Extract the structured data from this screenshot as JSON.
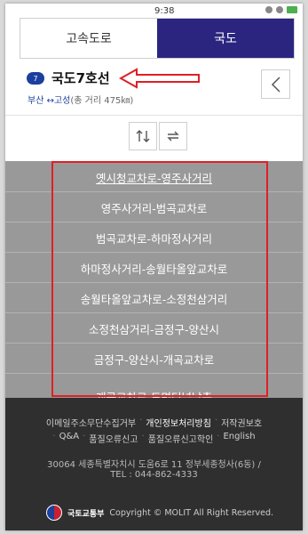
{
  "status_bar": {
    "time": "9:38"
  },
  "tabs": [
    {
      "label": "고속도로",
      "active": false
    },
    {
      "label": "국도",
      "active": true
    }
  ],
  "route": {
    "number": "7",
    "name": "국도7호선",
    "start": "부산",
    "arrow": "↔",
    "end": "고성",
    "distance": "(총 거리 475㎞)"
  },
  "controls": {
    "swap_icon": "swap-vertical-icon",
    "refresh_icon": "refresh-icon",
    "back_icon": "chevron-left-icon"
  },
  "sections": [
    "옛시청교차로-영주사거리",
    "영주사거리-범곡교차로",
    "범곡교차로-하마정사거리",
    "하마정사거리-송월타올앞교차로",
    "송월타올앞교차로-소정천삼거리",
    "소정천삼거리-금정구-양산시",
    "금정구-양산시-개곡교차로",
    "개곡교차로-도면터널남측"
  ],
  "footer": {
    "links_row1": [
      "이메일주소무단수집거부",
      "개인정보처리방침",
      "저작권보호"
    ],
    "links_row2": [
      "Q&A",
      "품질오류신고",
      "품질오류신고학인",
      "English"
    ],
    "address": "30064 세종특별자치시 도움6로 11 정부세종청사(6동) /",
    "tel": "TEL : 044-862-4333",
    "logo_text": "국토교통부",
    "copyright": "Copyright © MOLIT All Right Reserved."
  },
  "colors": {
    "accent": "#2b2580",
    "route_badge": "#1c3f9e",
    "annotation": "#e01f25"
  }
}
